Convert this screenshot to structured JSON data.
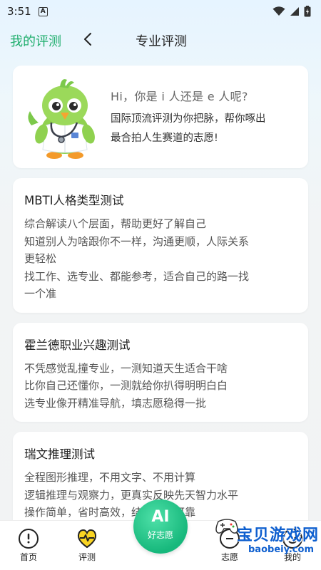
{
  "status_bar": {
    "time": "3:51",
    "notification_letter": "A"
  },
  "nav": {
    "my_tests": "我的评测",
    "title": "专业评测"
  },
  "intro": {
    "greeting": "Hi，你是 i 人还是 e 人呢?",
    "desc_lines": [
      "国际顶流评测为你把脉，帮你啄出",
      "最合拍人生赛道的志愿!"
    ]
  },
  "tests": [
    {
      "title": "MBTI人格类型测试",
      "lines": [
        "综合解读八个层面，帮助更好了解自己",
        "知道别人为啥跟你不一样，沟通更顺，人际关系",
        "更轻松",
        "找工作、选专业、都能参考，适合自己的路一找",
        "一个准"
      ]
    },
    {
      "title": "霍兰德职业兴趣测试",
      "lines": [
        "不凭感觉乱撞专业，一测知道天生适合干啥",
        "比你自己还懂你，一测就给你扒得明明白白",
        "选专业像开精准导航，填志愿稳得一批"
      ]
    },
    {
      "title": "瑞文推理测试",
      "lines": [
        "全程图形推理，不用文字、不用计算",
        "逻辑推理与观察力，更真实反映先天智力水平",
        "操作简单，省时高效，结果稳定可靠"
      ]
    }
  ],
  "bottom_nav": {
    "home": "首页",
    "assess": "评测",
    "ai_main": "AI",
    "ai_sub": "好志愿",
    "volunteer": "志愿",
    "mine": "我的"
  },
  "watermark": {
    "title": "宝贝游戏网",
    "url": "baobeiy.com"
  },
  "colors": {
    "accent": "#1fae6d",
    "ai_button": "#17b87c",
    "watermark": "#0e5fcf"
  }
}
